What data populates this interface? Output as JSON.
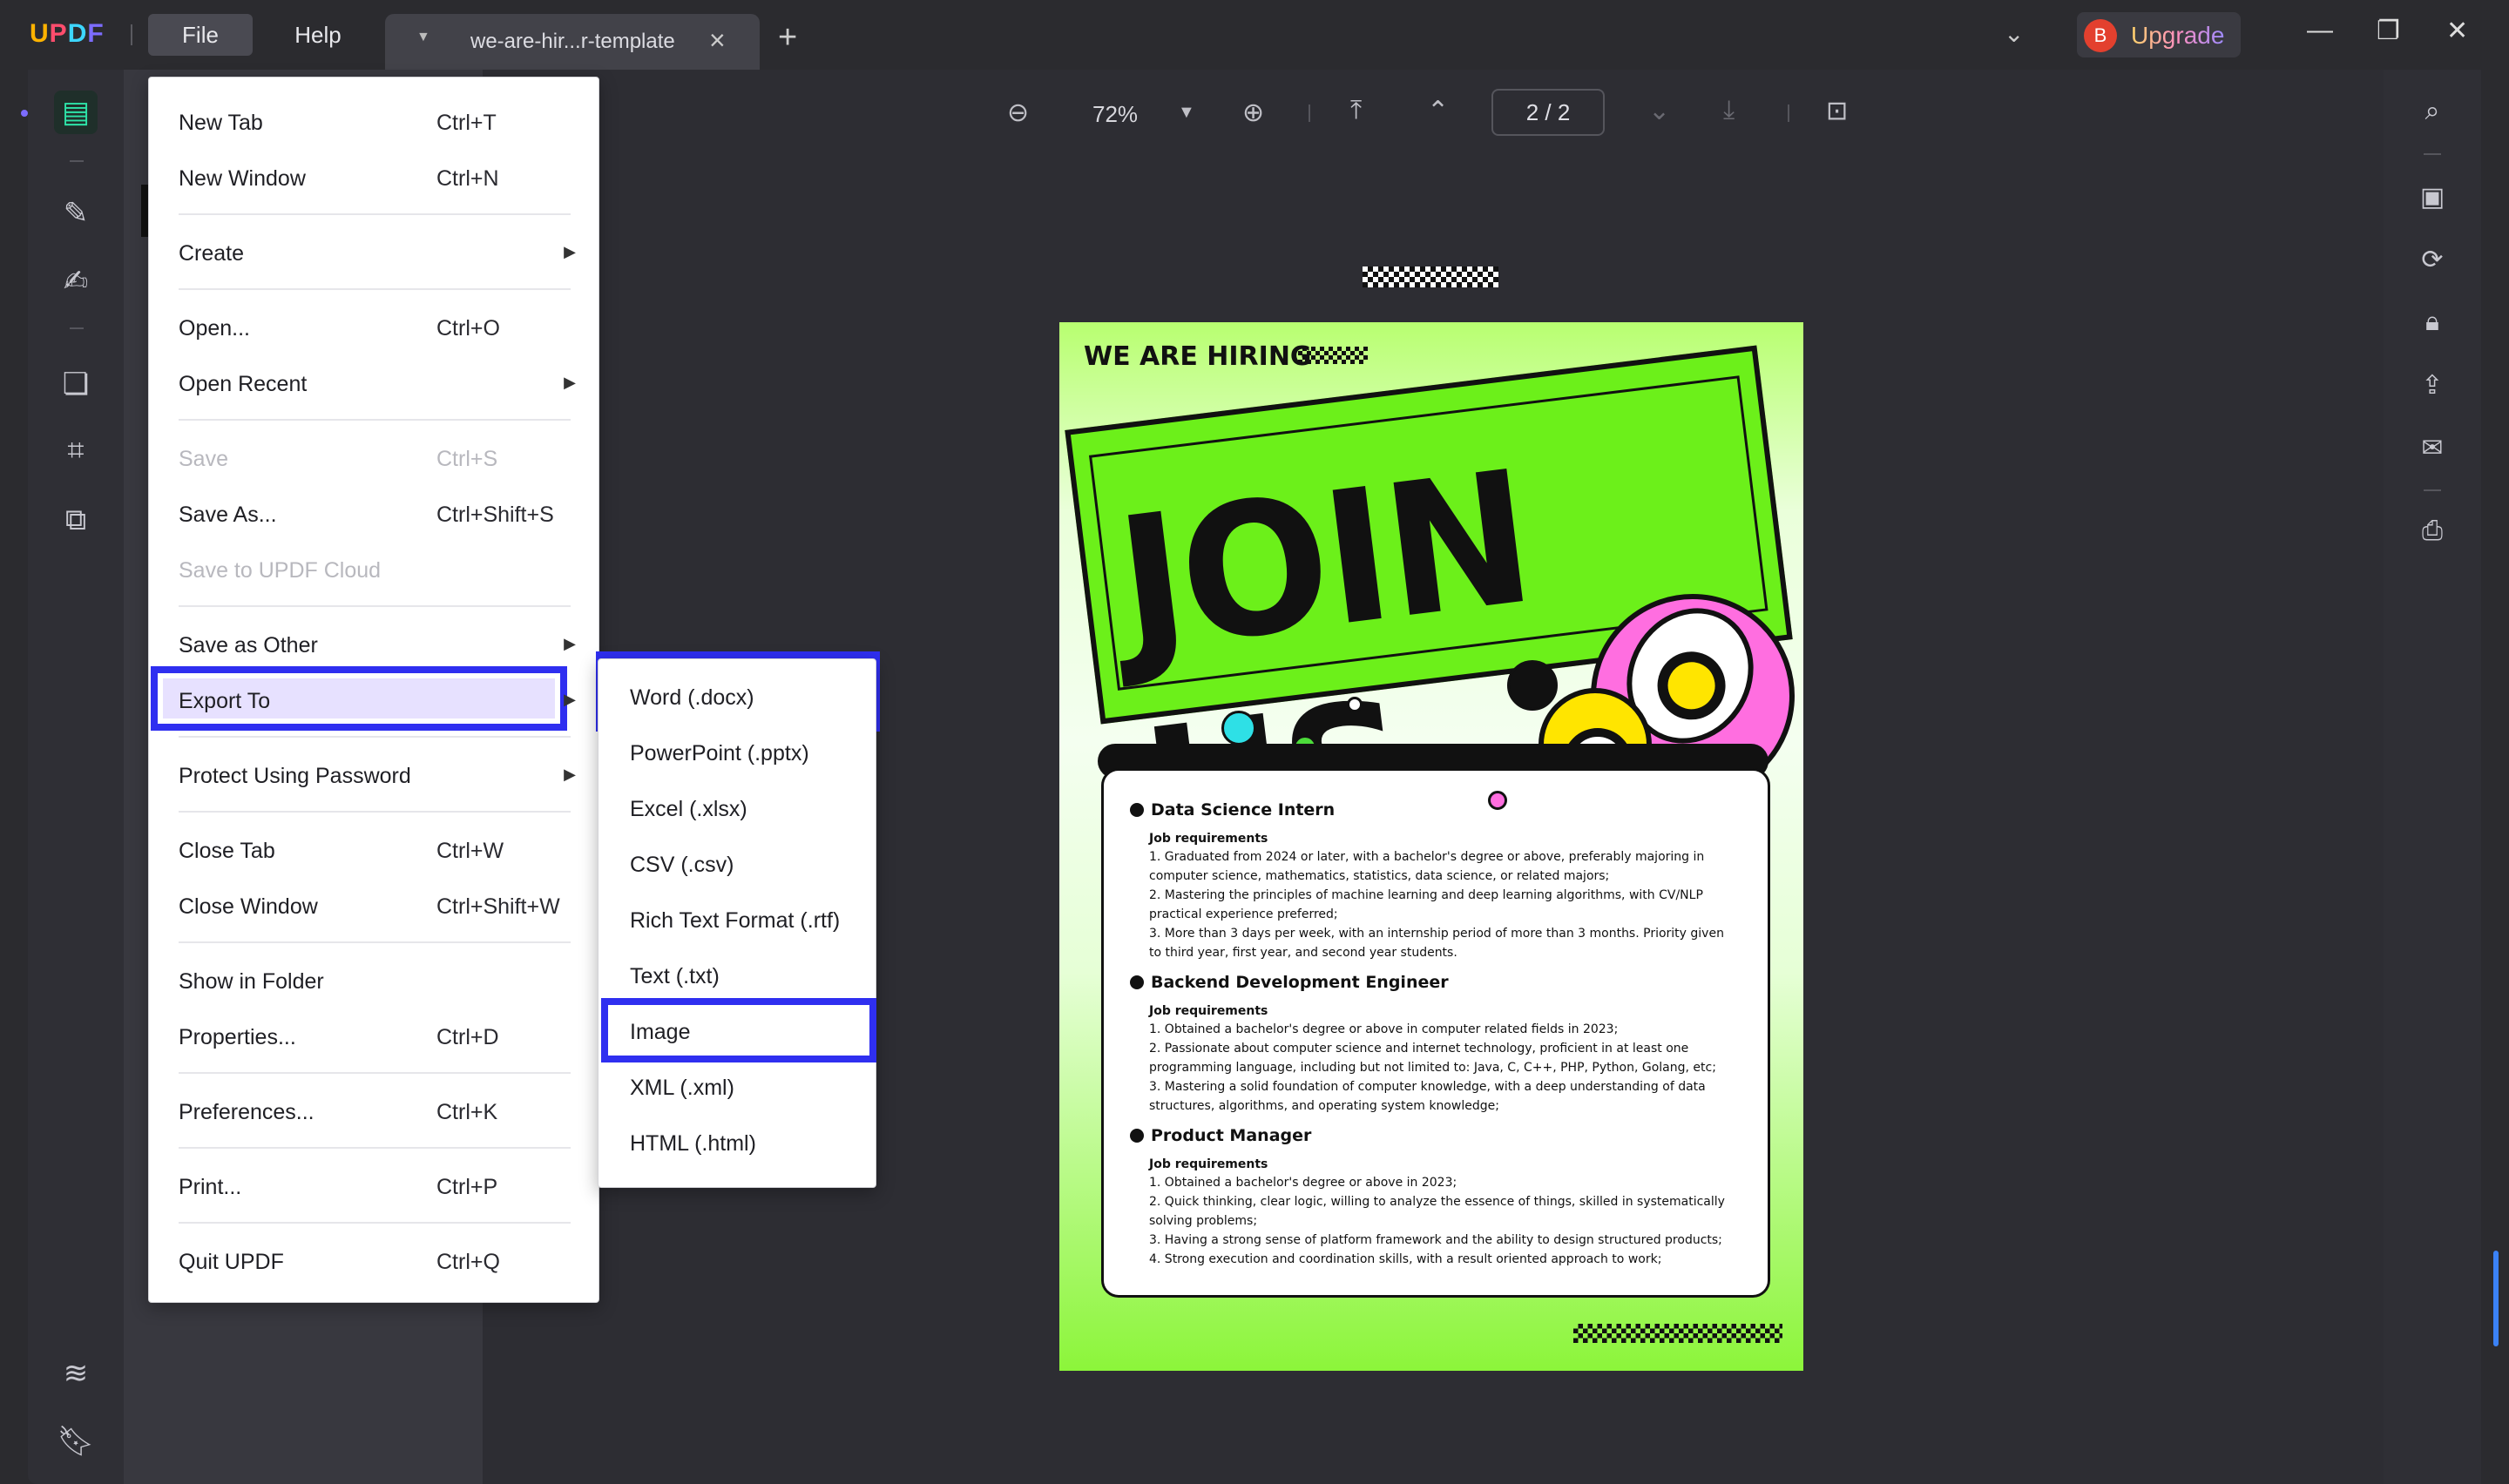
{
  "app": {
    "logo": [
      "U",
      "P",
      "D",
      "F"
    ]
  },
  "titlebar": {
    "file_label": "File",
    "help_label": "Help",
    "tab_title": "we-are-hir...r-template",
    "upgrade_label": "Upgrade",
    "avatar_letter": "B"
  },
  "toolbar": {
    "zoom": "72%",
    "page_indicator": "2  /  2"
  },
  "file_menu": {
    "items": [
      {
        "label": "New Tab",
        "shortcut": "Ctrl+T"
      },
      {
        "label": "New Window",
        "shortcut": "Ctrl+N"
      },
      {
        "label": "Create",
        "shortcut": ""
      },
      {
        "label": "Open...",
        "shortcut": "Ctrl+O"
      },
      {
        "label": "Open Recent",
        "shortcut": ""
      },
      {
        "label": "Save",
        "shortcut": "Ctrl+S"
      },
      {
        "label": "Save As...",
        "shortcut": "Ctrl+Shift+S"
      },
      {
        "label": "Save to UPDF Cloud",
        "shortcut": ""
      },
      {
        "label": "Save as Other",
        "shortcut": ""
      },
      {
        "label": "Export To",
        "shortcut": ""
      },
      {
        "label": "Protect Using Password",
        "shortcut": ""
      },
      {
        "label": "Close Tab",
        "shortcut": "Ctrl+W"
      },
      {
        "label": "Close Window",
        "shortcut": "Ctrl+Shift+W"
      },
      {
        "label": "Show in Folder",
        "shortcut": ""
      },
      {
        "label": "Properties...",
        "shortcut": "Ctrl+D"
      },
      {
        "label": "Preferences...",
        "shortcut": "Ctrl+K"
      },
      {
        "label": "Print...",
        "shortcut": "Ctrl+P"
      },
      {
        "label": "Quit UPDF",
        "shortcut": "Ctrl+Q"
      }
    ]
  },
  "export_menu": {
    "items": [
      "Word (.docx)",
      "PowerPoint (.pptx)",
      "Excel (.xlsx)",
      "CSV (.csv)",
      "Rich Text Format (.rtf)",
      "Text (.txt)",
      "Image",
      "XML (.xml)",
      "HTML (.html)"
    ]
  },
  "poster": {
    "header": "WE ARE HIRING",
    "headline": "JOIN US",
    "jobs": [
      {
        "title": "Data Science Intern",
        "req_label": "Job requirements",
        "lines": [
          "1. Graduated from 2024 or later, with a bachelor's degree or above, preferably majoring in",
          "computer science, mathematics, statistics, data science, or related majors;",
          "2. Mastering the principles of machine learning and deep learning algorithms, with CV/NLP",
          "practical experience preferred;",
          "3. More than 3 days per week, with an internship period of more than 3 months. Priority given",
          "to third year, first year, and second year students."
        ]
      },
      {
        "title": "Backend Development Engineer",
        "req_label": "Job requirements",
        "lines": [
          "1. Obtained a bachelor's degree or above in computer related fields in 2023;",
          "2. Passionate about computer science and internet technology, proficient in at least one",
          "programming language, including but not limited to: Java, C, C++, PHP, Python, Golang, etc;",
          "3. Mastering a solid foundation of computer knowledge, with a deep understanding of data",
          "structures, algorithms, and operating system knowledge;"
        ]
      },
      {
        "title": "Product Manager",
        "req_label": "Job requirements",
        "lines": [
          "1. Obtained a bachelor's degree or above in 2023;",
          "2. Quick thinking, clear logic, willing to analyze the essence of things, skilled in systematically",
          "solving problems;",
          "3. Having a strong sense of platform framework and the ability to design structured products;",
          "4. Strong execution and coordination skills, with a result oriented approach to work;"
        ]
      }
    ]
  },
  "colors": {
    "highlight": "#2f2ff0",
    "poster_green": "#6cf01a",
    "accent": "#2ee3a8"
  }
}
